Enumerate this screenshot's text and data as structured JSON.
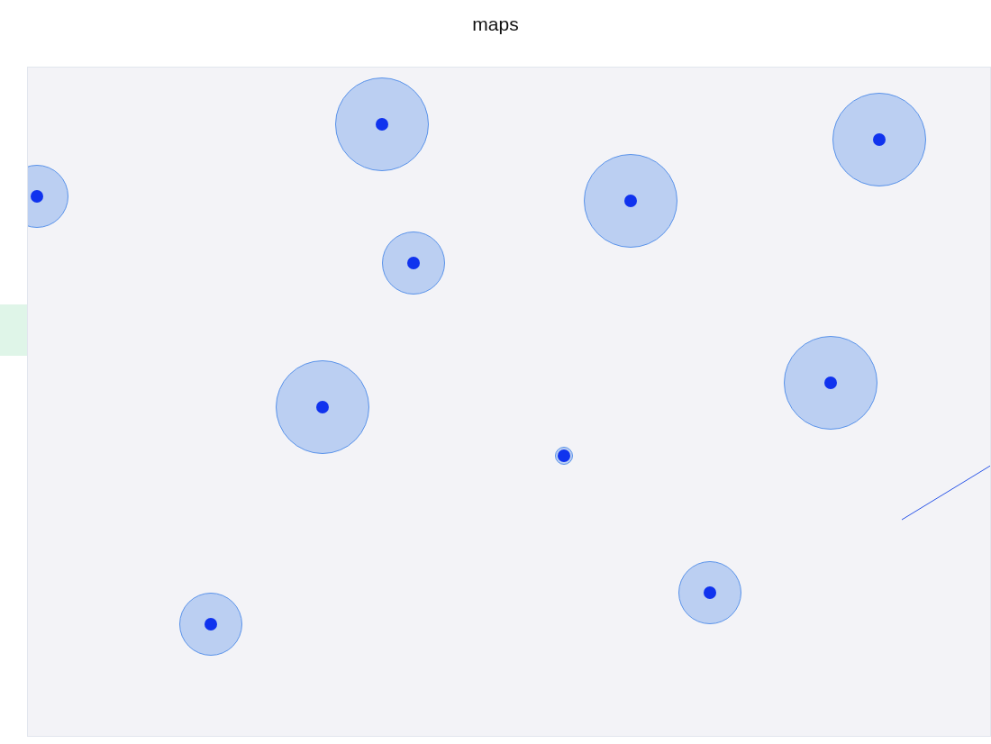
{
  "title": "maps",
  "markers": [
    {
      "kind": "medium"
    },
    {
      "kind": "large"
    },
    {
      "kind": "medium"
    },
    {
      "kind": "large"
    },
    {
      "kind": "medium"
    },
    {
      "kind": "small"
    },
    {
      "kind": "large"
    },
    {
      "kind": "large"
    },
    {
      "kind": "large"
    },
    {
      "kind": "medium"
    }
  ]
}
